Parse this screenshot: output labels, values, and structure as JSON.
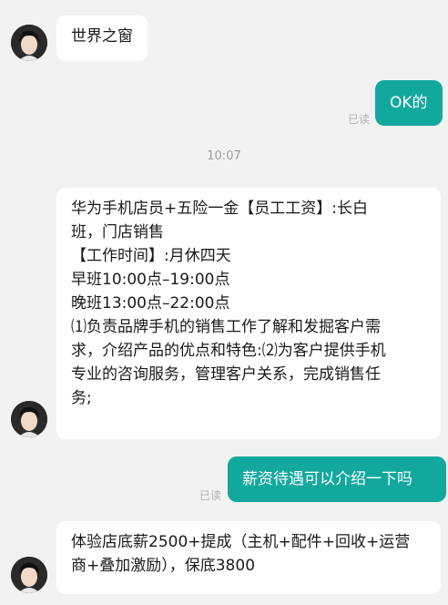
{
  "messages": [
    {
      "side": "in",
      "text": "世界之窗"
    },
    {
      "side": "out",
      "text": "OK的",
      "status": "已读"
    },
    {
      "side": "time",
      "text": "10:07"
    },
    {
      "side": "in",
      "lines": [
        "华为手机店员+五险一金【员工工资】:长白",
        "班，门店销售",
        "【工作时间】:月休四天",
        "早班10:00点–19:00点",
        "晚班13:00点–22:00点",
        "⑴负责品牌手机的销售工作了解和发掘客户需",
        "求，介绍产品的优点和特色:⑵为客户提供手机",
        "专业的咨询服务，管理客户关系，完成销售任",
        "务;"
      ]
    },
    {
      "side": "out",
      "text": "薪资待遇可以介绍一下吗",
      "status": "已读"
    },
    {
      "side": "in",
      "lines": [
        "体验店底薪2500+提成（主机+配件+回收+运营",
        "商+叠加激励），保底3800"
      ]
    }
  ],
  "colors": {
    "outgoing_bubble": "#13a89e",
    "incoming_bubble": "#ffffff",
    "background": "#f2f2f2"
  }
}
